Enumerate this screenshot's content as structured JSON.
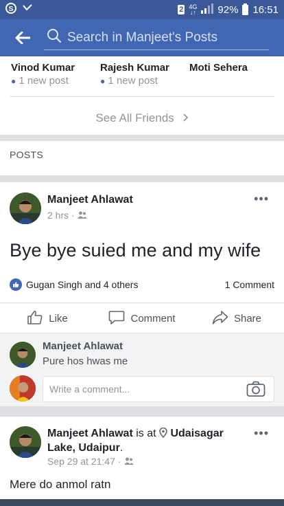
{
  "status_bar": {
    "sim": "2",
    "network_top": "4G",
    "network_bottom": "↓↑",
    "battery": "92%",
    "time": "16:51"
  },
  "app_bar": {
    "search_placeholder": "Search in Manjeet's Posts"
  },
  "friends": {
    "items": [
      {
        "name": "Vinod Kumar",
        "status": "1 new post"
      },
      {
        "name": "Rajesh Kumar",
        "status": "1 new post"
      },
      {
        "name": "Moti Sehera",
        "status": ""
      }
    ],
    "see_all": "See All Friends"
  },
  "posts_section": {
    "label": "POSTS"
  },
  "post1": {
    "author": "Manjeet Ahlawat",
    "time": "2 hrs",
    "body": "Bye bye suied me and my wife",
    "reactions": "Gugan Singh and 4 others",
    "comment_count": "1 Comment",
    "actions": {
      "like": "Like",
      "comment": "Comment",
      "share": "Share"
    },
    "comment": {
      "author": "Manjeet Ahlawat",
      "text": "Pure hos hwas me"
    },
    "write_placeholder": "Write a comment..."
  },
  "post2": {
    "author": "Manjeet Ahlawat",
    "is_at": "is at",
    "place": "Udaisagar Lake, Udaipur",
    "period": ".",
    "time": "Sep 29 at 21:47",
    "body": "Mere do anmol ratn"
  },
  "colors": {
    "status_bar": "#3b5998",
    "app_bar": "#4267b2",
    "accent": "#4267b2"
  }
}
